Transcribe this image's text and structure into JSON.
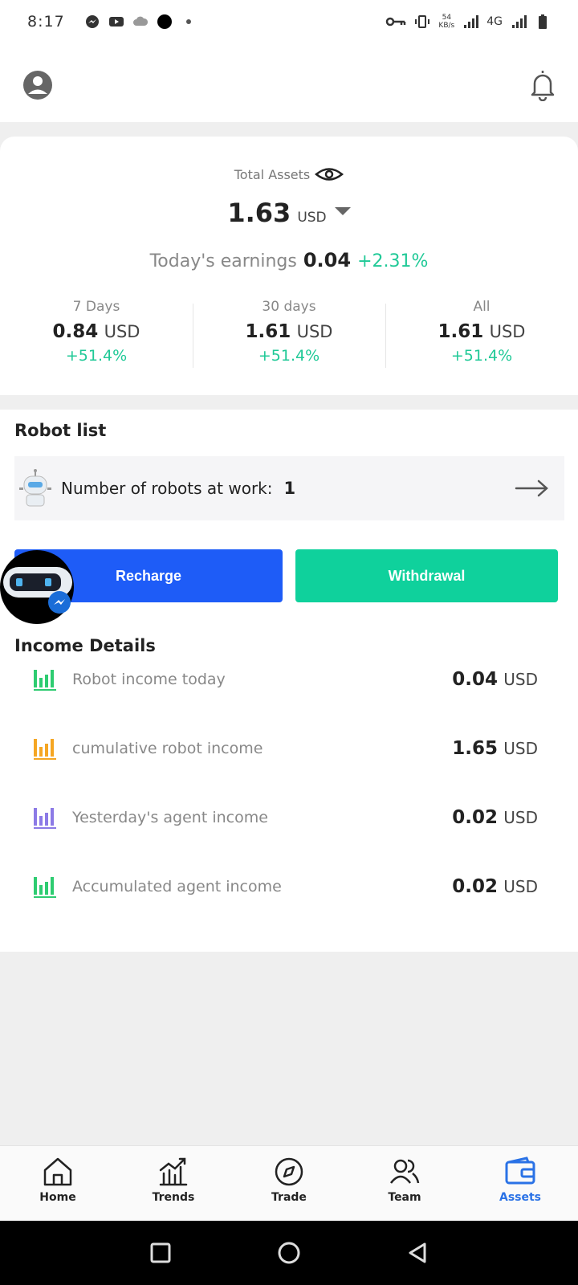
{
  "status_bar": {
    "time": "8:17",
    "speed_value": "54",
    "speed_unit": "KB/s",
    "network": "4G"
  },
  "header": {
    "avatar_icon": "user-avatar-icon",
    "bell_icon": "bell-icon"
  },
  "assets": {
    "total_label": "Total Assets",
    "total_amount": "1.63",
    "total_unit": "USD",
    "today_label": "Today's earnings",
    "today_value": "0.04",
    "today_pct": "+2.31%",
    "stats": [
      {
        "label": "7 Days",
        "value": "0.84",
        "unit": "USD",
        "pct": "+51.4%"
      },
      {
        "label": "30 days",
        "value": "1.61",
        "unit": "USD",
        "pct": "+51.4%"
      },
      {
        "label": "All",
        "value": "1.61",
        "unit": "USD",
        "pct": "+51.4%"
      }
    ]
  },
  "robots": {
    "title": "Robot list",
    "working_label": "Number of robots at work:",
    "working_count": "1"
  },
  "actions": {
    "recharge": "Recharge",
    "withdrawal": "Withdrawal"
  },
  "income": {
    "title": "Income Details",
    "rows": [
      {
        "label": "Robot income today",
        "value": "0.04",
        "unit": "USD",
        "color": "#2ecc71"
      },
      {
        "label": "cumulative robot income",
        "value": "1.65",
        "unit": "USD",
        "color": "#f5a623"
      },
      {
        "label": "Yesterday's agent income",
        "value": "0.02",
        "unit": "USD",
        "color": "#8c7ae6"
      },
      {
        "label": "Accumulated agent income",
        "value": "0.02",
        "unit": "USD",
        "color": "#2ecc71"
      }
    ]
  },
  "nav": {
    "items": [
      {
        "label": "Home",
        "icon": "home-icon"
      },
      {
        "label": "Trends",
        "icon": "chart-icon"
      },
      {
        "label": "Trade",
        "icon": "compass-icon"
      },
      {
        "label": "Team",
        "icon": "team-icon"
      },
      {
        "label": "Assets",
        "icon": "wallet-icon"
      }
    ],
    "active_index": 4,
    "active_color": "#2a72e6"
  },
  "colors": {
    "positive": "#20c997",
    "recharge_button": "#1e5cf7",
    "withdraw_button": "#0fd19c"
  }
}
